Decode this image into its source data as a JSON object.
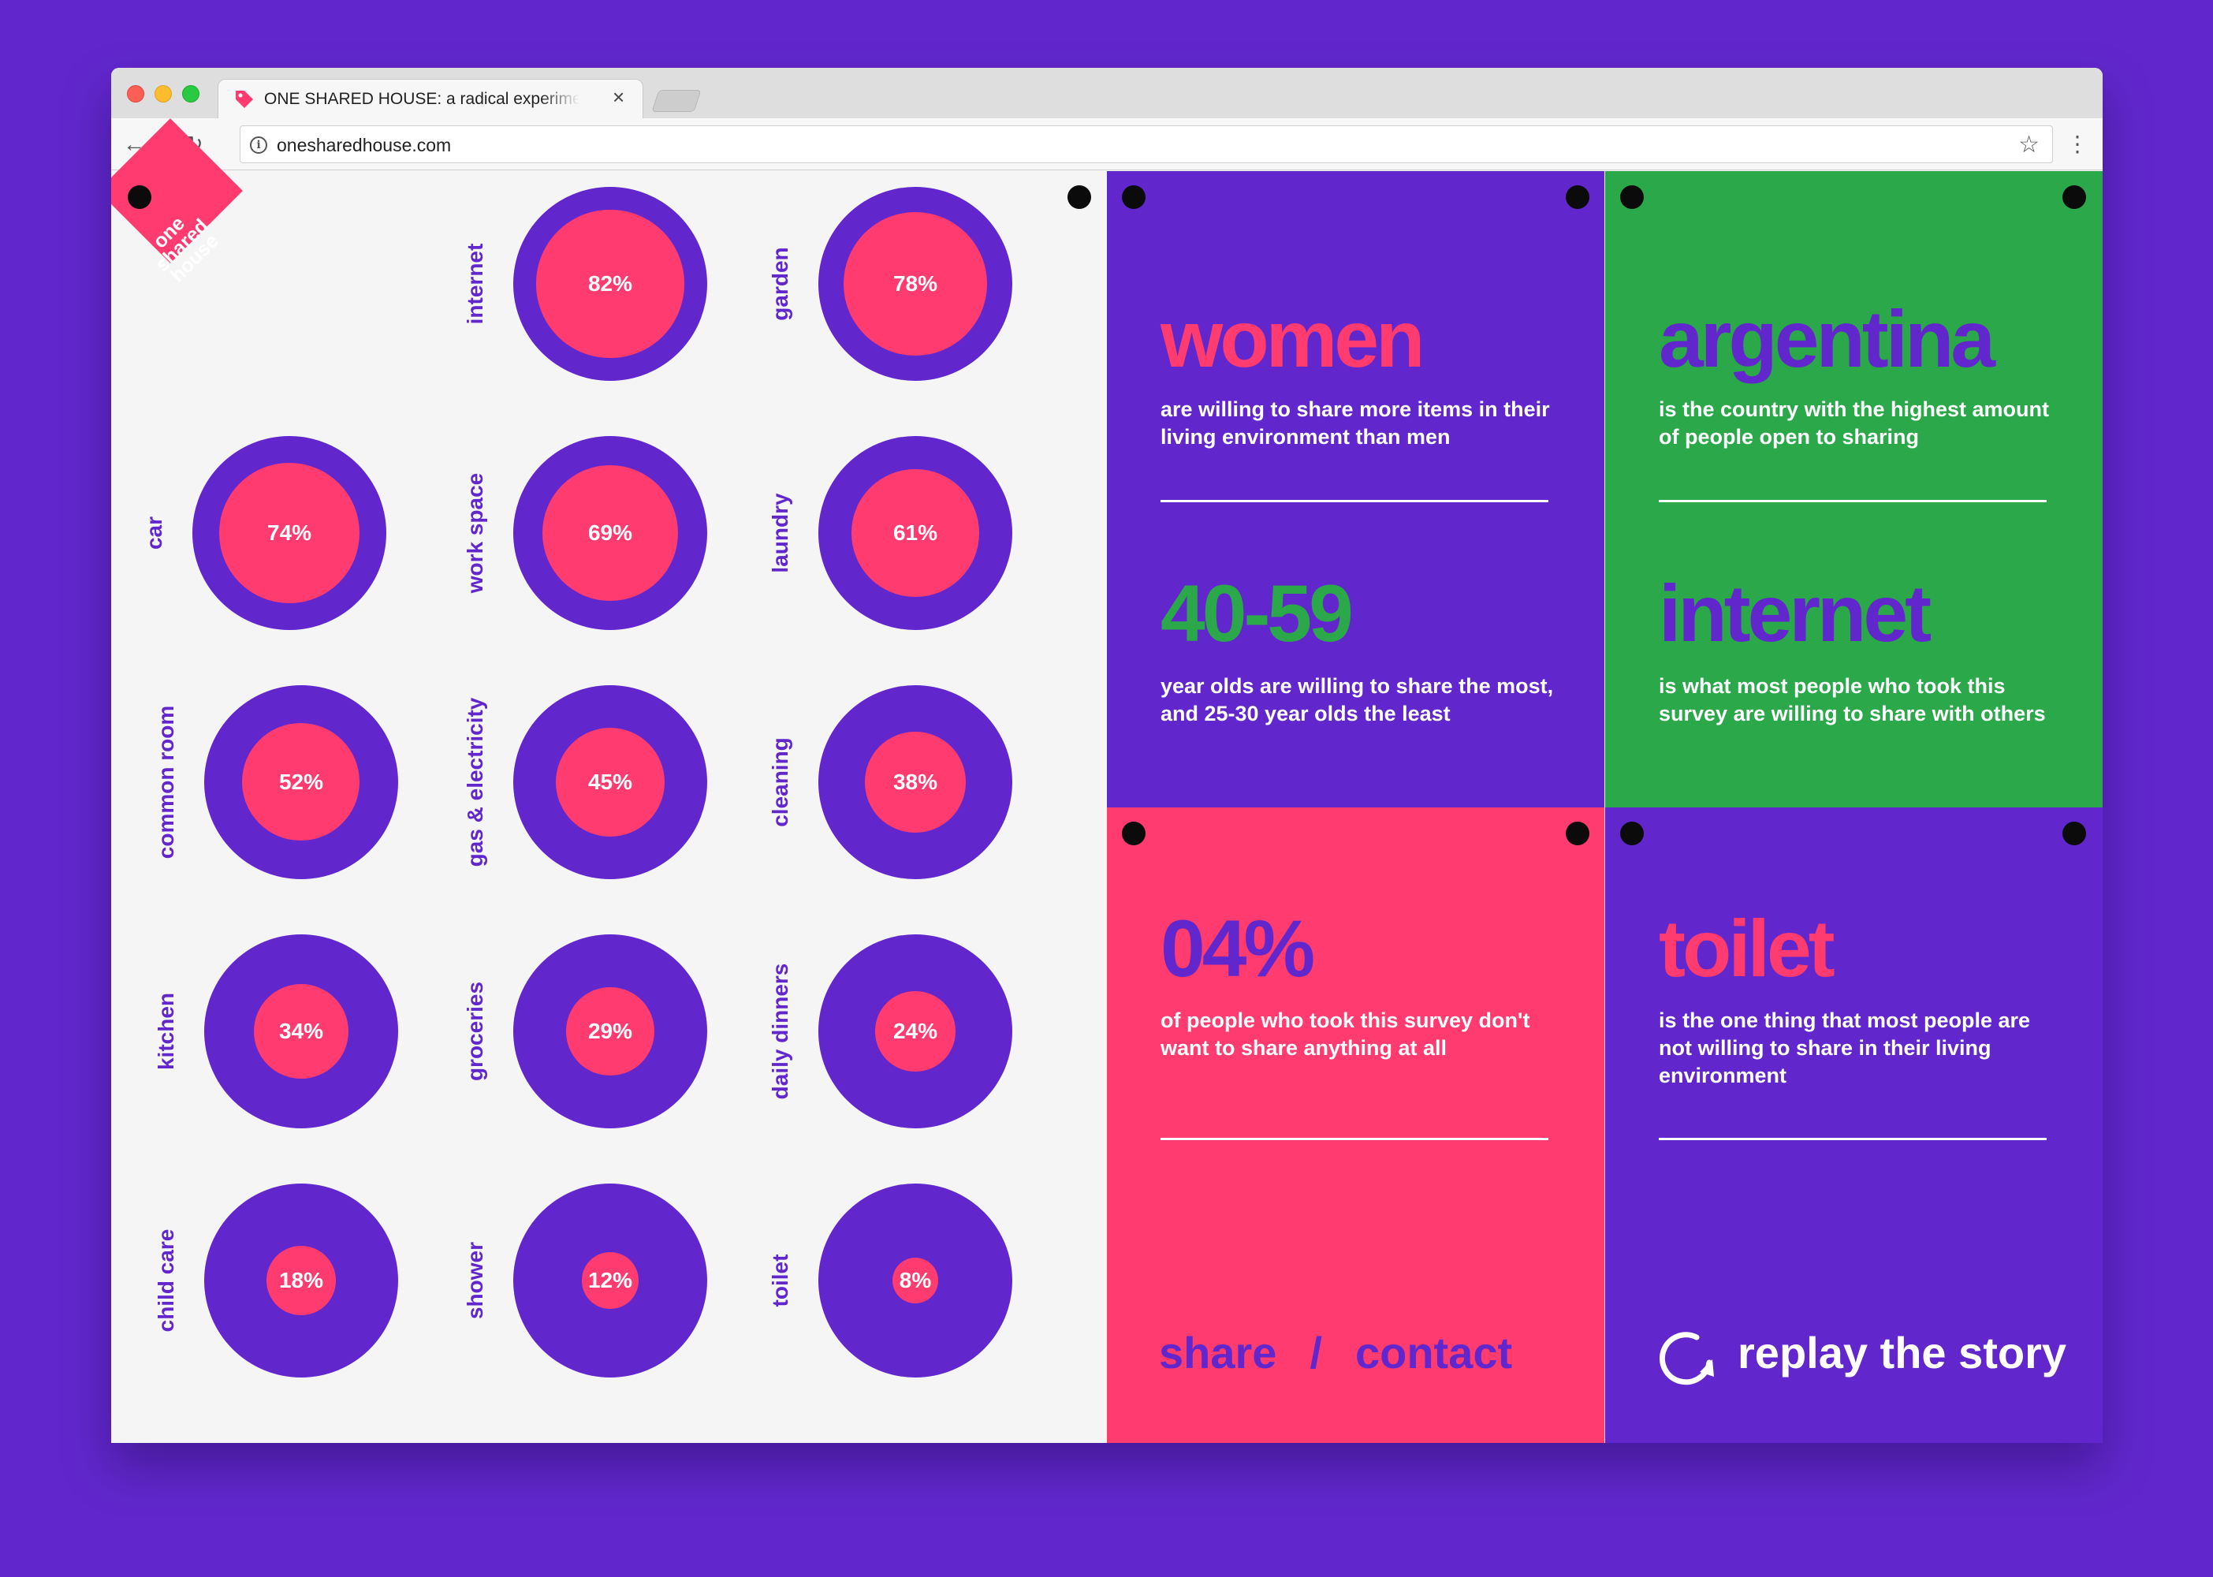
{
  "browser": {
    "tab_title": "ONE SHARED HOUSE: a radical experiment",
    "tab_close": "×",
    "url": "onesharedhouse.com"
  },
  "logo": {
    "line1": "one",
    "line2": "shared",
    "line3": "house"
  },
  "stats": [
    {
      "label": "internet",
      "value": "82%",
      "fraction": 0.82
    },
    {
      "label": "garden",
      "value": "78%",
      "fraction": 0.78
    },
    {
      "label": "car",
      "value": "74%",
      "fraction": 0.74
    },
    {
      "label": "work space",
      "value": "69%",
      "fraction": 0.69
    },
    {
      "label": "laundry",
      "value": "61%",
      "fraction": 0.61
    },
    {
      "label": "common room",
      "value": "52%",
      "fraction": 0.52
    },
    {
      "label": "gas & electricity",
      "value": "45%",
      "fraction": 0.45
    },
    {
      "label": "cleaning",
      "value": "38%",
      "fraction": 0.38
    },
    {
      "label": "kitchen",
      "value": "34%",
      "fraction": 0.34
    },
    {
      "label": "groceries",
      "value": "29%",
      "fraction": 0.29
    },
    {
      "label": "daily dinners",
      "value": "24%",
      "fraction": 0.24
    },
    {
      "label": "child care",
      "value": "18%",
      "fraction": 0.18
    },
    {
      "label": "shower",
      "value": "12%",
      "fraction": 0.12
    },
    {
      "label": "toilet",
      "value": "8%",
      "fraction": 0.08
    }
  ],
  "cards": {
    "women": {
      "headline": "women",
      "text": "are willing to share more items in their living environment than men"
    },
    "age": {
      "headline": "40-59",
      "text": "year olds are willing to share the most, and 25-30 year olds the least"
    },
    "argentina": {
      "headline": "argentina",
      "text": "is the country with the highest amount of people open to sharing"
    },
    "internet": {
      "headline": "internet",
      "text": "is what most people who took this survey are willing to share with others"
    },
    "nothing": {
      "headline": "04%",
      "text": "of people who took this survey don't want to share anything at all"
    },
    "toilet": {
      "headline": "toilet",
      "text": "is the one thing that most people are not willing to share in their living environment"
    }
  },
  "footer": {
    "share": "share",
    "slash": "/",
    "contact": "contact",
    "replay": "replay the story"
  },
  "colors": {
    "purple": "#6127cc",
    "pink": "#ff3b6f",
    "green": "#2aa84a"
  }
}
